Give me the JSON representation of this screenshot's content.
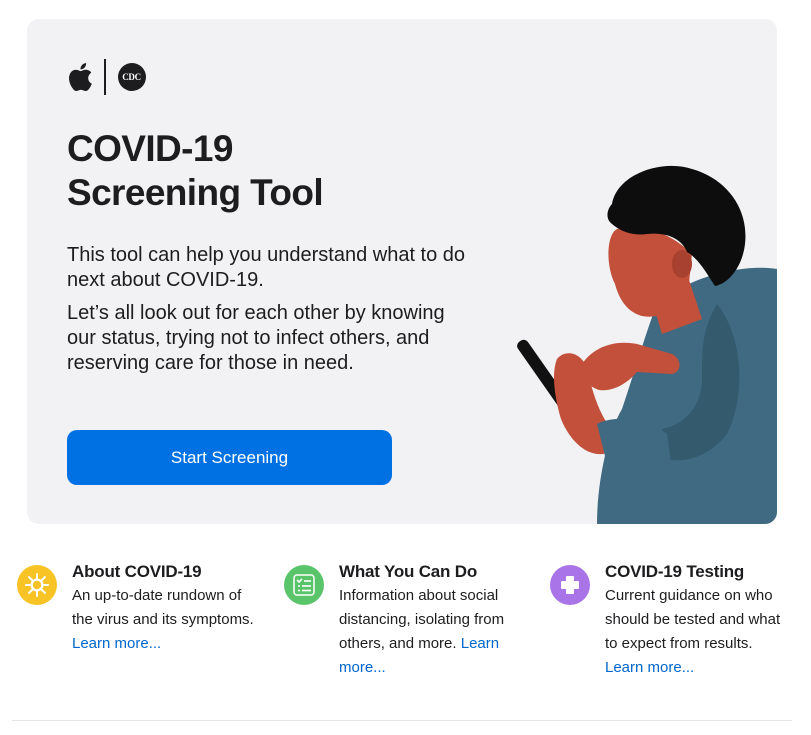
{
  "hero": {
    "logos": {
      "apple": "apple-icon",
      "cdc_text": "CDC"
    },
    "title_line1": "COVID-19",
    "title_line2": "Screening Tool",
    "paragraph1": "This tool can help you understand what to do next about COVID-19.",
    "paragraph2": "Let’s all look out for each other by knowing our status, trying not to infect others, and reserving care for those in need.",
    "cta_label": "Start Screening"
  },
  "features": [
    {
      "icon": "virus-icon",
      "icon_color": "#f7c325",
      "title": "About COVID-19",
      "description": "An up-to-date rundown of the virus and its symptoms.",
      "link": "Learn more..."
    },
    {
      "icon": "checklist-icon",
      "icon_color": "#5ac46a",
      "title": "What You Can Do",
      "description": "Information about social distancing, isolating from others, and more.",
      "link": "Learn more..."
    },
    {
      "icon": "medical-cross-icon",
      "icon_color": "#a874e8",
      "title": "COVID-19 Testing",
      "description": "Current guidance on who should be tested and what to expect from results.",
      "link": "Learn more..."
    }
  ],
  "colors": {
    "accent": "#0071e3",
    "link": "#0066cc",
    "hero_bg": "#f2f2f4",
    "text": "#1d1d1f"
  }
}
